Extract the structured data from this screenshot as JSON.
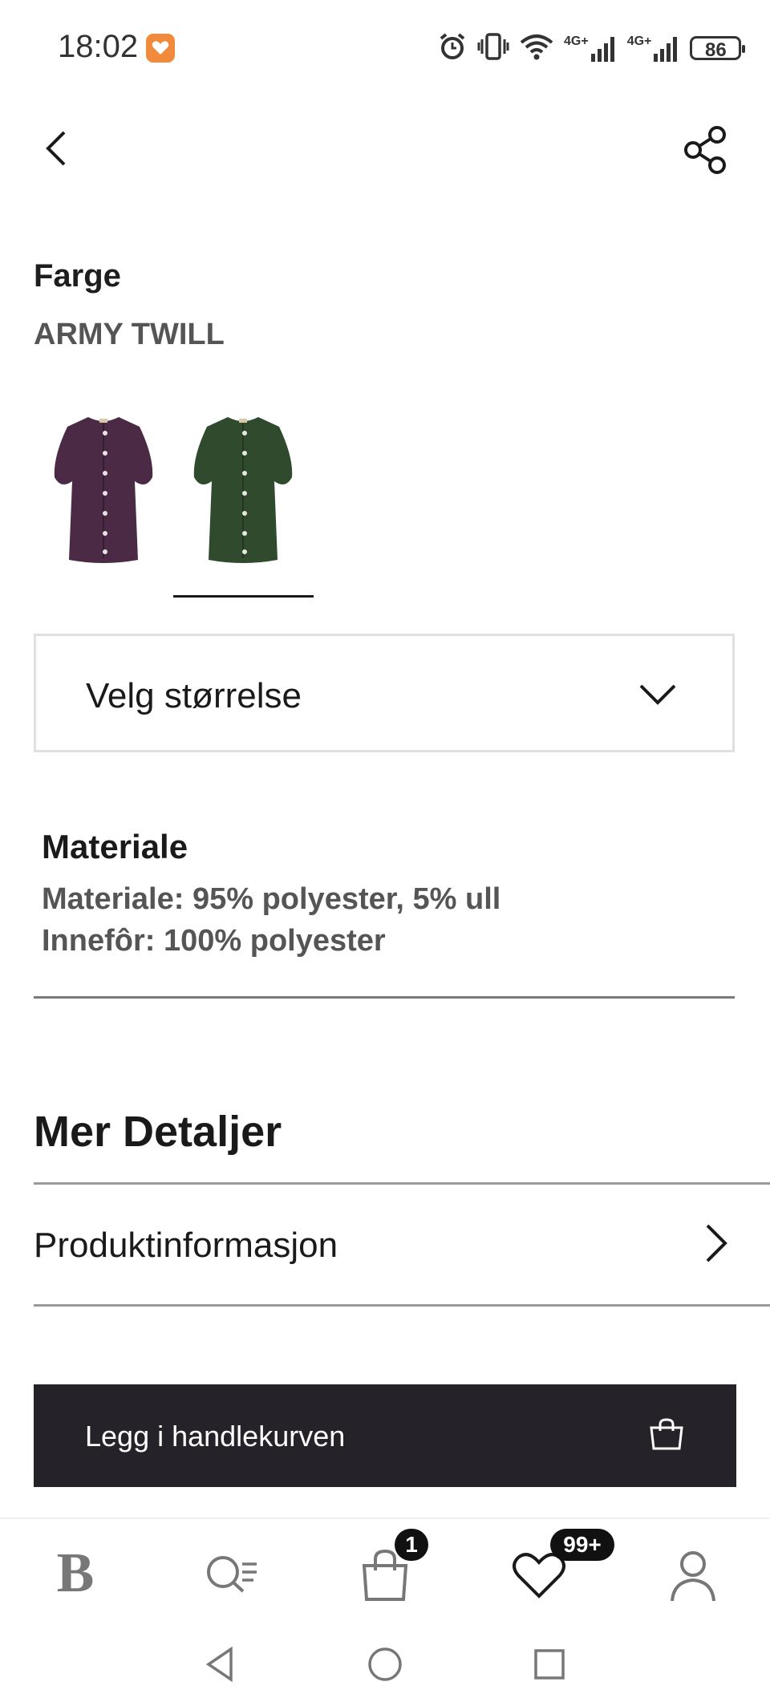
{
  "status_bar": {
    "time": "18:02",
    "network_1": "4G+",
    "network_2": "4G+",
    "battery": "86"
  },
  "header": {
    "back_icon": "chevron-left-icon",
    "share_icon": "share-icon"
  },
  "color": {
    "label": "Farge",
    "value": "ARMY TWILL",
    "swatches": [
      {
        "name": "purple-dress",
        "color": "#4a2a45",
        "selected": false
      },
      {
        "name": "green-dress",
        "color": "#2f4a2c",
        "selected": true
      }
    ]
  },
  "size_select": {
    "label": "Velg størrelse",
    "icon": "chevron-down-icon"
  },
  "material": {
    "title": "Materiale",
    "line_1": "Materiale: 95% polyester, 5% ull",
    "line_2": "Innefôr: 100% polyester"
  },
  "more_details": {
    "title": "Mer Detaljer",
    "items": [
      {
        "label": "Produktinformasjon",
        "icon": "chevron-right-icon"
      }
    ]
  },
  "add_to_cart": {
    "label": "Legg i handlekurven",
    "icon": "shopping-bag-icon",
    "background": "#26222a"
  },
  "bottom_nav": {
    "home_logo": "B",
    "bag_badge": "1",
    "wishlist_badge": "99+"
  }
}
